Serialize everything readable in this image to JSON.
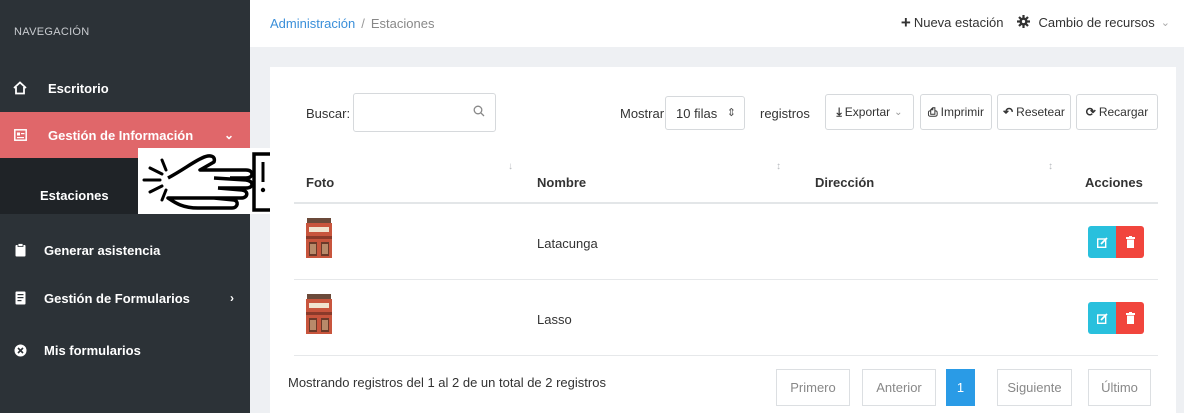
{
  "sidebar": {
    "title": "NAVEGACIÓN",
    "items": [
      {
        "label": "Escritorio",
        "icon": "home-icon"
      },
      {
        "label": "Gestión de Información",
        "icon": "id-card-icon",
        "active": true
      },
      {
        "label": "Estaciones"
      },
      {
        "label": "Generar asistencia",
        "icon": "clipboard-icon"
      },
      {
        "label": "Gestión de Formularios",
        "icon": "form-icon"
      },
      {
        "label": "Mis formularios",
        "icon": "close-circle-icon"
      }
    ]
  },
  "breadcrumb": {
    "root": "Administración",
    "sep": "/",
    "current": "Estaciones"
  },
  "topbar": {
    "new_station": "Nueva estación",
    "resources": "Cambio de recursos"
  },
  "toolbar": {
    "search_label": "Buscar:",
    "search_value": "",
    "show_label": "Mostrar",
    "rows_value": "10 filas",
    "records_label": "registros",
    "export": "Exportar",
    "print": "Imprimir",
    "reset": "Resetear",
    "reload": "Recargar"
  },
  "table": {
    "columns": [
      "Foto",
      "Nombre",
      "Dirección",
      "Acciones"
    ],
    "rows": [
      {
        "name": "Latacunga",
        "address": ""
      },
      {
        "name": "Lasso",
        "address": ""
      }
    ]
  },
  "footer": {
    "info": "Mostrando registros del 1 al 2 de un total de 2 registros",
    "first": "Primero",
    "prev": "Anterior",
    "page": "1",
    "next": "Siguiente",
    "last": "Último"
  },
  "colors": {
    "sidebar_bg": "#2c3237",
    "active_item": "#e0676a",
    "link": "#3a8fd9",
    "edit": "#29c0dd",
    "delete": "#f1453d",
    "pager_active": "#2a9be6"
  }
}
